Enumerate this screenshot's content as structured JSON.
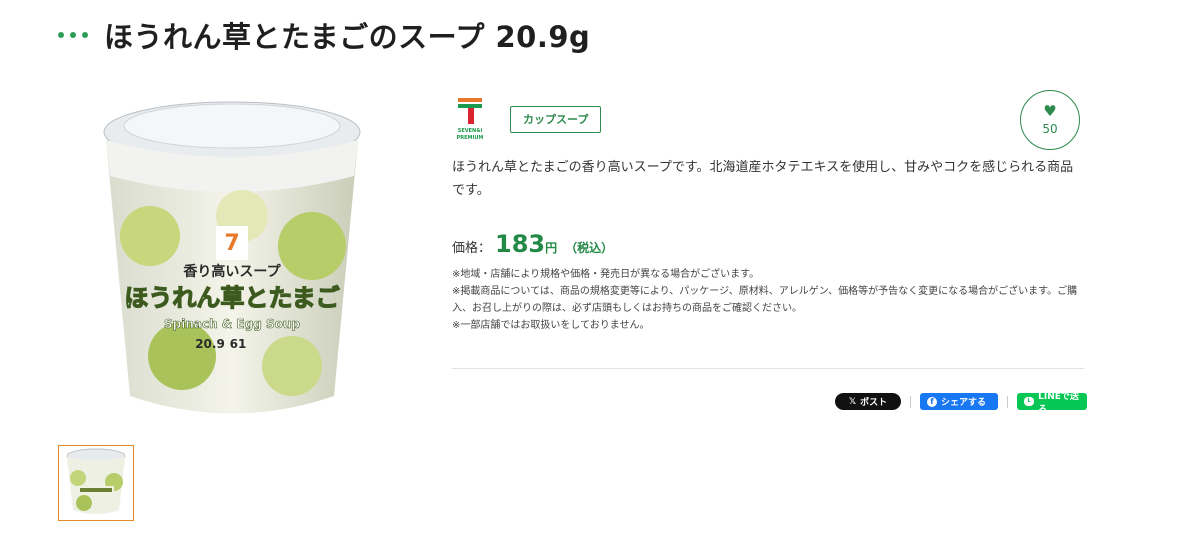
{
  "header": {
    "title": "ほうれん草とたまごのスープ 20.9g"
  },
  "product": {
    "image_alt": "Spinach & Egg Soup cup",
    "pack_label_top": "香り高いスープ",
    "pack_label_main": "ほうれん草とたまご",
    "pack_label_en": "Spinach & Egg Soup",
    "pack_weight": "20.9",
    "pack_kcal": "61"
  },
  "brand": {
    "logo_name": "SEVEN&i PREMIUM",
    "logo_top": "SEVEN&i",
    "logo_bottom": "PREMIUM",
    "category": "カップスープ"
  },
  "like": {
    "count": "50"
  },
  "description": "ほうれん草とたまごの香り高いスープです。北海道産ホタテエキスを使用し、甘みやコクを感じられる商品です。",
  "price": {
    "label": "価格：",
    "value": "183",
    "unit": "円",
    "tax": "（税込）"
  },
  "notes": [
    "※地域・店舗により規格や価格・発売日が異なる場合がございます。",
    "※掲載商品については、商品の規格変更等により、パッケージ、原材料、アレルゲン、価格等が予告なく変更になる場合がございます。ご購入、お召し上がりの際は、必ず店頭もしくはお持ちの商品をご確認ください。",
    "※一部店舗ではお取扱いをしておりません。"
  ],
  "share": {
    "x_label": "ポスト",
    "x_glyph": "𝕏",
    "fb_label": "シェアする",
    "line_label": "LINEで送る"
  },
  "colors": {
    "accent": "#2e8a4d",
    "price": "#238a46",
    "facebook": "#1877f2",
    "line": "#06c755",
    "x": "#111111",
    "thumb_border": "#e58a2b"
  }
}
